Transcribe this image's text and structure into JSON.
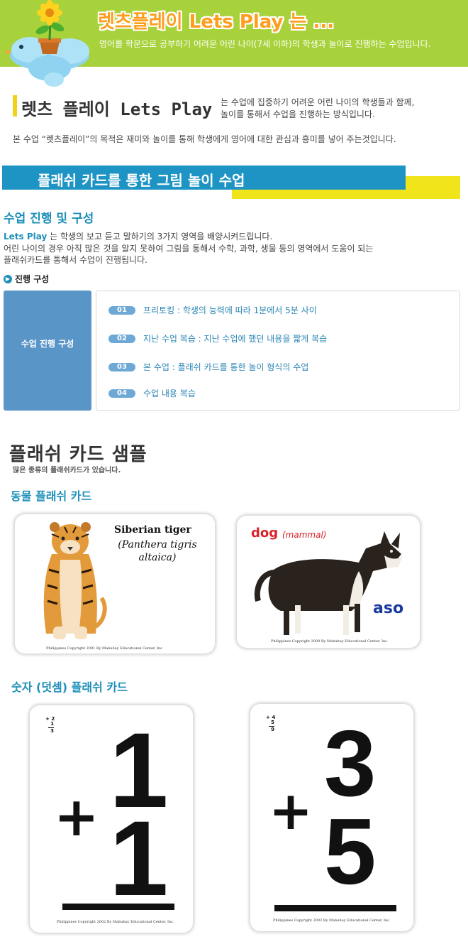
{
  "header": {
    "title": "렛츠플레이 Lets Play 는 ...",
    "subtitle": "영어를 학문으로 공부하기 어려운 어린 나이(7세 이하)의 학생과 놀이로 진행하는 수업입니다."
  },
  "intro": {
    "brand": "렛츠 플레이 Lets Play",
    "desc_line1": "는 수업에 집중하기 어려운 어린 나이의 학생들과 함께,",
    "desc_line2": "놀이를 통해서 수업을 진행하는 방식입니다.",
    "purpose": "본 수업 “렛츠플레이”의 목적은 재미와 놀이를 통해 학생에게 영어에 대한 관심과  흥미를 넣어 주는것입니다."
  },
  "banner": {
    "title": "플래쉬 카드를 통한 그림 놀이 수업"
  },
  "structure": {
    "title": "수업 진행 및 구성",
    "brand": "Lets Play",
    "line1": " 는 학생의 보고 듣고 말하기의 3가지 영역을 배양시켜드립니다.",
    "line2": "어린 나이의 경우 아직 많은 것을 알지 못하여 그림을 통해서 수학, 과학, 생물 등의 영역에서 도움이 되는",
    "line3": "플래쉬카드를 통해서 수업이 진행됩니다.",
    "subtitle": "진행 구성",
    "box_label": "수업 진행 구성",
    "steps": [
      {
        "num": "01",
        "text": "프리토킹 : 학생의 능력에 따라 1분에서 5분 사이"
      },
      {
        "num": "02",
        "text": "지난 수업 복습 : 지난 수업에 했던 내용을 짧게 복습"
      },
      {
        "num": "03",
        "text": "본 수업 : 플래쉬 카드를 통한 놀이 형식의 수업"
      },
      {
        "num": "04",
        "text": "수업 내용 복습"
      }
    ]
  },
  "samples": {
    "title": "플래쉬 카드 샘플",
    "subtitle": "많은 종류의 플래쉬카드가 있습니다.",
    "animal_title": "동물 플래쉬 카드",
    "number_title": "숫자 (덧셈) 플래쉬 카드",
    "tiger": {
      "name": "Siberian tiger",
      "sci": "(Panthera tigris altaica)",
      "copyright": "Philippines Copyright 2001 By Mabuhay Educational Center, Inc."
    },
    "dog": {
      "name": "dog",
      "class": "(mammal)",
      "word": "aso",
      "copyright": "Philippines Copyright 2000 By Mabuhay Educational Center, Inc."
    },
    "card1": {
      "small_top": "2",
      "small_mid": "1",
      "small_bot": "3",
      "plus": "+",
      "top": "1",
      "bottom": "1",
      "copyright": "Philippines Copyright 2002 By Mabuhay Educational Center, Inc."
    },
    "card2": {
      "small_top": "4",
      "small_mid": "5",
      "small_bot": "9",
      "plus": "+",
      "top": "3",
      "bottom": "5",
      "copyright": "Philippines Copyright 2002 By Mabuhay Educational Center, Inc."
    }
  },
  "colors": {
    "header_bg": "#a8d23b",
    "accent_blue": "#1d94c4",
    "accent_yellow": "#f0e41a",
    "title_orange": "#ff9d1f"
  }
}
